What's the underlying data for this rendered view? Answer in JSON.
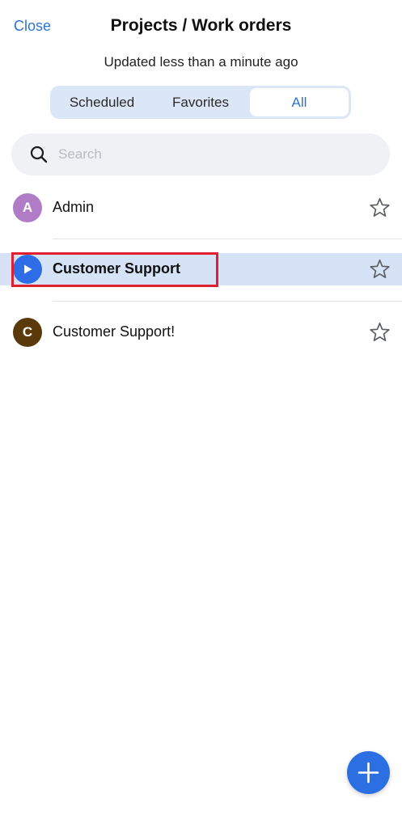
{
  "header": {
    "close_label": "Close",
    "title": "Projects / Work orders",
    "subtitle": "Updated less than a minute ago"
  },
  "tabs": [
    {
      "label": "Scheduled",
      "active": false
    },
    {
      "label": "Favorites",
      "active": false
    },
    {
      "label": "All",
      "active": true
    }
  ],
  "search": {
    "placeholder": "Search",
    "value": ""
  },
  "items": [
    {
      "avatar_letter": "A",
      "avatar_color": "#b07cc6",
      "label": "Admin",
      "icon": "star-outline-icon",
      "selected": false
    },
    {
      "avatar_letter": "",
      "avatar_color": "#2f6de6",
      "avatar_icon": "play-icon",
      "label": "Customer Support",
      "icon": "star-outline-icon",
      "selected": true
    },
    {
      "avatar_letter": "C",
      "avatar_color": "#5a3a0a",
      "label": "Customer Support!",
      "icon": "star-outline-icon",
      "selected": false
    }
  ],
  "fab": {
    "icon": "plus-icon"
  },
  "colors": {
    "accent": "#2a73d9",
    "selected_row": "#d6e2f6",
    "highlight": "#e0202f"
  }
}
